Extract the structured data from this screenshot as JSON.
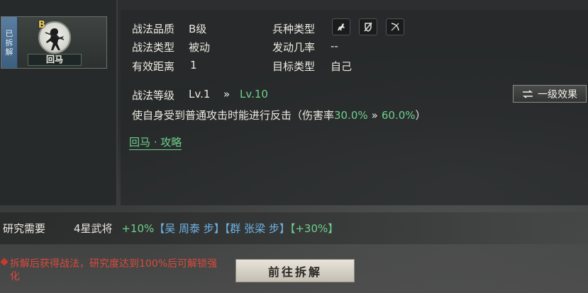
{
  "card": {
    "tag_chars": [
      "已",
      "拆",
      "解"
    ],
    "grade": "B",
    "name": "回马"
  },
  "info": {
    "quality_label": "战法品质",
    "quality_value": "B级",
    "type_label": "战法类型",
    "type_value": "被动",
    "range_label": "有效距离",
    "range_value": "1",
    "troop_label": "兵种类型",
    "troop_icons": [
      "cavalry-icon",
      "shield-icon",
      "archer-icon"
    ],
    "rate_label": "发动几率",
    "rate_value": "--",
    "target_label": "目标类型",
    "target_value": "自己"
  },
  "level": {
    "label": "战法等级",
    "current": "Lv.1",
    "arrow": "»",
    "max": "Lv.10",
    "effect_button": "一级效果",
    "effect_icon": "swap-icon"
  },
  "description": {
    "prefix": "使自身受到普通攻击时能进行反击（伤害率",
    "value_low": "30.0%",
    "arrow": "»",
    "value_high": "60.0%",
    "suffix": "）"
  },
  "guide_link": "回马 · 攻略",
  "research": {
    "label": "研究需要",
    "requirement": "4星武将",
    "bonus1": "+10%",
    "hero1": "【吴 周泰 步】",
    "hero2": "【群 张梁 步】",
    "bonus2": "【+30%】"
  },
  "note": "拆解后获得战法，研究度达到100%后可解锁强化",
  "go_button": "前往拆解",
  "colors": {
    "accent_green": "#6fd08b",
    "accent_blue": "#6fb3e4",
    "warning_red": "#d94b3c",
    "grade_gold": "#e9c95a"
  }
}
